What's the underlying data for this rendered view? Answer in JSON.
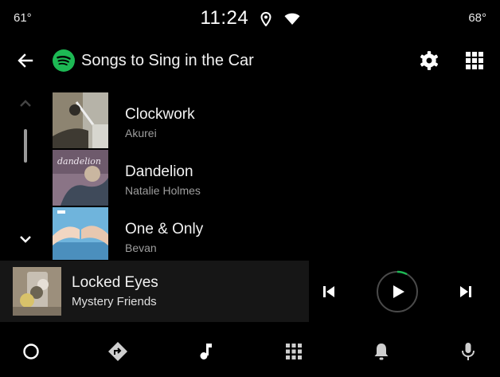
{
  "status": {
    "temp_left": "61°",
    "time": "11:24",
    "temp_right": "68°"
  },
  "header": {
    "title": "Songs to Sing in the Car",
    "app_icon": "spotify-icon"
  },
  "tracks": [
    {
      "title": "Clockwork",
      "artist": "Akurei"
    },
    {
      "title": "Dandelion",
      "artist": "Natalie Holmes",
      "art_text": "dandelion"
    },
    {
      "title": "One & Only",
      "artist": "Bevan"
    }
  ],
  "now_playing": {
    "title": "Locked Eyes",
    "artist": "Mystery Friends",
    "progress": 0.08
  },
  "nav": [
    "home-icon",
    "navigation-icon",
    "music-icon",
    "apps-grid-icon",
    "notifications-icon",
    "microphone-icon"
  ],
  "colors": {
    "accent": "#1DB954",
    "background": "#000000",
    "player_bg": "#161616",
    "secondary_text": "#9e9e9e"
  }
}
